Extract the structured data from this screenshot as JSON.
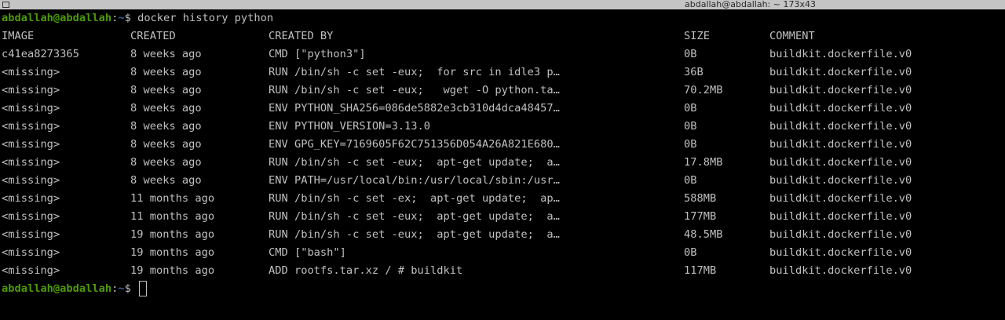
{
  "window": {
    "title": "abdallah@abdallah: ~ 173x43"
  },
  "prompt": {
    "user_host": "abdallah@abdallah",
    "colon": ":",
    "path": "~",
    "symbol": "$ "
  },
  "command": "docker history python",
  "table": {
    "headers": [
      "IMAGE",
      "CREATED",
      "CREATED BY",
      "SIZE",
      "COMMENT"
    ],
    "rows": [
      [
        "c41ea8273365",
        "8 weeks ago",
        "CMD [\"python3\"]",
        "0B",
        "buildkit.dockerfile.v0"
      ],
      [
        "<missing>",
        "8 weeks ago",
        "RUN /bin/sh -c set -eux;  for src in idle3 p…",
        "36B",
        "buildkit.dockerfile.v0"
      ],
      [
        "<missing>",
        "8 weeks ago",
        "RUN /bin/sh -c set -eux;   wget -O python.ta…",
        "70.2MB",
        "buildkit.dockerfile.v0"
      ],
      [
        "<missing>",
        "8 weeks ago",
        "ENV PYTHON_SHA256=086de5882e3cb310d4dca48457…",
        "0B",
        "buildkit.dockerfile.v0"
      ],
      [
        "<missing>",
        "8 weeks ago",
        "ENV PYTHON_VERSION=3.13.0",
        "0B",
        "buildkit.dockerfile.v0"
      ],
      [
        "<missing>",
        "8 weeks ago",
        "ENV GPG_KEY=7169605F62C751356D054A26A821E680…",
        "0B",
        "buildkit.dockerfile.v0"
      ],
      [
        "<missing>",
        "8 weeks ago",
        "RUN /bin/sh -c set -eux;  apt-get update;  a…",
        "17.8MB",
        "buildkit.dockerfile.v0"
      ],
      [
        "<missing>",
        "8 weeks ago",
        "ENV PATH=/usr/local/bin:/usr/local/sbin:/usr…",
        "0B",
        "buildkit.dockerfile.v0"
      ],
      [
        "<missing>",
        "11 months ago",
        "RUN /bin/sh -c set -ex;  apt-get update;  ap…",
        "588MB",
        "buildkit.dockerfile.v0"
      ],
      [
        "<missing>",
        "11 months ago",
        "RUN /bin/sh -c set -eux;  apt-get update;  a…",
        "177MB",
        "buildkit.dockerfile.v0"
      ],
      [
        "<missing>",
        "19 months ago",
        "RUN /bin/sh -c set -eux;  apt-get update;  a…",
        "48.5MB",
        "buildkit.dockerfile.v0"
      ],
      [
        "<missing>",
        "19 months ago",
        "CMD [\"bash\"]",
        "0B",
        "buildkit.dockerfile.v0"
      ],
      [
        "<missing>",
        "19 months ago",
        "ADD rootfs.tar.xz / # buildkit",
        "117MB",
        "buildkit.dockerfile.v0"
      ]
    ]
  },
  "colors": {
    "user": "#4e9a06",
    "path": "#3465a4",
    "text": "#c0c0c0",
    "background": "#000000"
  }
}
